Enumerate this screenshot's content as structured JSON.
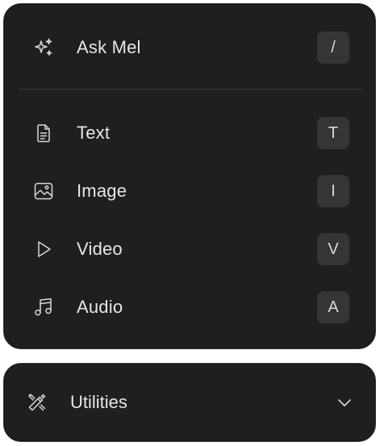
{
  "menu": {
    "ask": {
      "label": "Ask Mel",
      "shortcut": "/",
      "icon": "sparkles-icon"
    },
    "items": [
      {
        "label": "Text",
        "shortcut": "T",
        "icon": "document-icon"
      },
      {
        "label": "Image",
        "shortcut": "I",
        "icon": "image-icon"
      },
      {
        "label": "Video",
        "shortcut": "V",
        "icon": "play-icon"
      },
      {
        "label": "Audio",
        "shortcut": "A",
        "icon": "music-note-icon"
      }
    ]
  },
  "utilities": {
    "label": "Utilities",
    "icon": "tools-icon",
    "expand_icon": "chevron-down-icon"
  },
  "colors": {
    "panel_bg": "#1f1f1f",
    "text": "#e6e6e6",
    "key_bg": "#353535",
    "divider": "#3b3b3b"
  }
}
